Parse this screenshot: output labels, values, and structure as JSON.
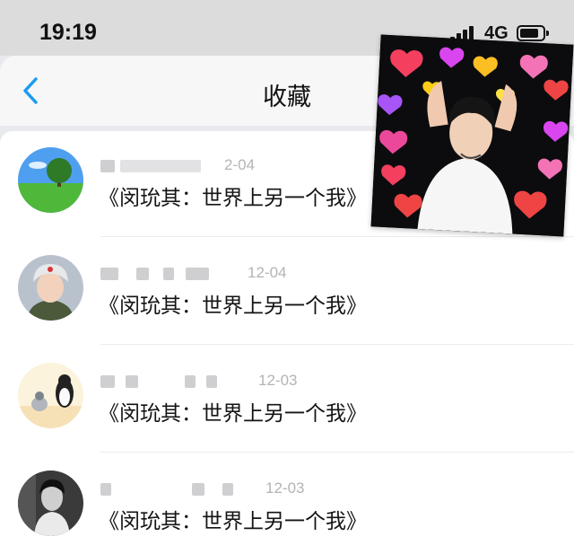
{
  "status_bar": {
    "time": "19:19",
    "network": "4G"
  },
  "nav": {
    "title": "收藏"
  },
  "items": [
    {
      "date": "2-04",
      "title": "《闵玧其：世界上另一个我》"
    },
    {
      "date": "12-04",
      "title": "《闵玧其：世界上另一个我》"
    },
    {
      "date": "12-03",
      "title": "《闵玧其：世界上另一个我》"
    },
    {
      "date": "12-03",
      "title": "《闵玧其：世界上另一个我》"
    }
  ],
  "colors": {
    "accent": "#1a9cf0",
    "date_gray": "#b4b4b8"
  },
  "icons": [
    "back-chevron-icon",
    "signal-icon",
    "battery-icon"
  ]
}
